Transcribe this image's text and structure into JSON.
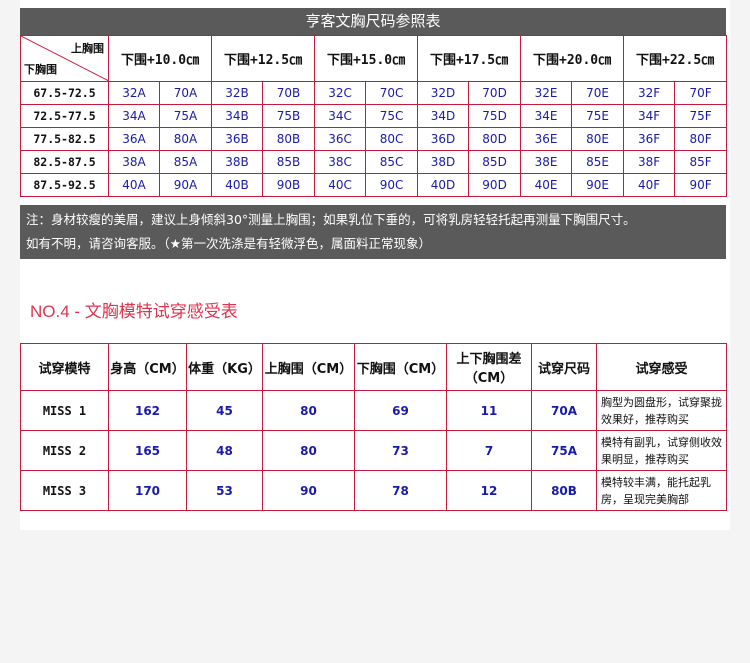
{
  "size_chart": {
    "title": "亨客文胸尺码参照表",
    "corner_top": "上胸围",
    "corner_bottom": "下胸围",
    "columns": [
      "下围+10.0㎝",
      "下围+12.5㎝",
      "下围+15.0㎝",
      "下围+17.5㎝",
      "下围+20.0㎝",
      "下围+22.5㎝"
    ],
    "rows": [
      {
        "range": "67.5-72.5",
        "cells": [
          "32A",
          "70A",
          "32B",
          "70B",
          "32C",
          "70C",
          "32D",
          "70D",
          "32E",
          "70E",
          "32F",
          "70F"
        ]
      },
      {
        "range": "72.5-77.5",
        "cells": [
          "34A",
          "75A",
          "34B",
          "75B",
          "34C",
          "75C",
          "34D",
          "75D",
          "34E",
          "75E",
          "34F",
          "75F"
        ]
      },
      {
        "range": "77.5-82.5",
        "cells": [
          "36A",
          "80A",
          "36B",
          "80B",
          "36C",
          "80C",
          "36D",
          "80D",
          "36E",
          "80E",
          "36F",
          "80F"
        ]
      },
      {
        "range": "82.5-87.5",
        "cells": [
          "38A",
          "85A",
          "38B",
          "85B",
          "38C",
          "85C",
          "38D",
          "85D",
          "38E",
          "85E",
          "38F",
          "85F"
        ]
      },
      {
        "range": "87.5-92.5",
        "cells": [
          "40A",
          "90A",
          "40B",
          "90B",
          "40C",
          "90C",
          "40D",
          "90D",
          "40E",
          "90E",
          "40F",
          "90F"
        ]
      }
    ]
  },
  "note": {
    "line1": "注：身材较瘦的美眉，建议上身倾斜30°测量上胸围；如果乳位下垂的，可将乳房轻轻托起再测量下胸围尺寸。",
    "line2": "如有不明，请咨询客服。（★第一次洗涤是有轻微浮色，属面料正常现象）"
  },
  "fit_section": {
    "title": "NO.4 - 文胸模特试穿感受表",
    "headers": [
      "试穿模特",
      "身高（CM）",
      "体重（KG）",
      "上胸围（CM）",
      "下胸围（CM）",
      "上下胸围差（CM）",
      "试穿尺码",
      "试穿感受"
    ],
    "rows": [
      {
        "model": "MISS 1",
        "height": "162",
        "weight": "45",
        "upper": "80",
        "lower": "69",
        "diff": "11",
        "size": "70A",
        "feel": "胸型为圆盘形，试穿聚拢效果好，推荐购买"
      },
      {
        "model": "MISS 2",
        "height": "165",
        "weight": "48",
        "upper": "80",
        "lower": "73",
        "diff": "7",
        "size": "75A",
        "feel": "模特有副乳，试穿侧收效果明显，推荐购买"
      },
      {
        "model": "MISS 3",
        "height": "170",
        "weight": "53",
        "upper": "90",
        "lower": "78",
        "diff": "12",
        "size": "80B",
        "feel": "模特较丰满，能托起乳房，呈现完美胸部"
      }
    ]
  }
}
